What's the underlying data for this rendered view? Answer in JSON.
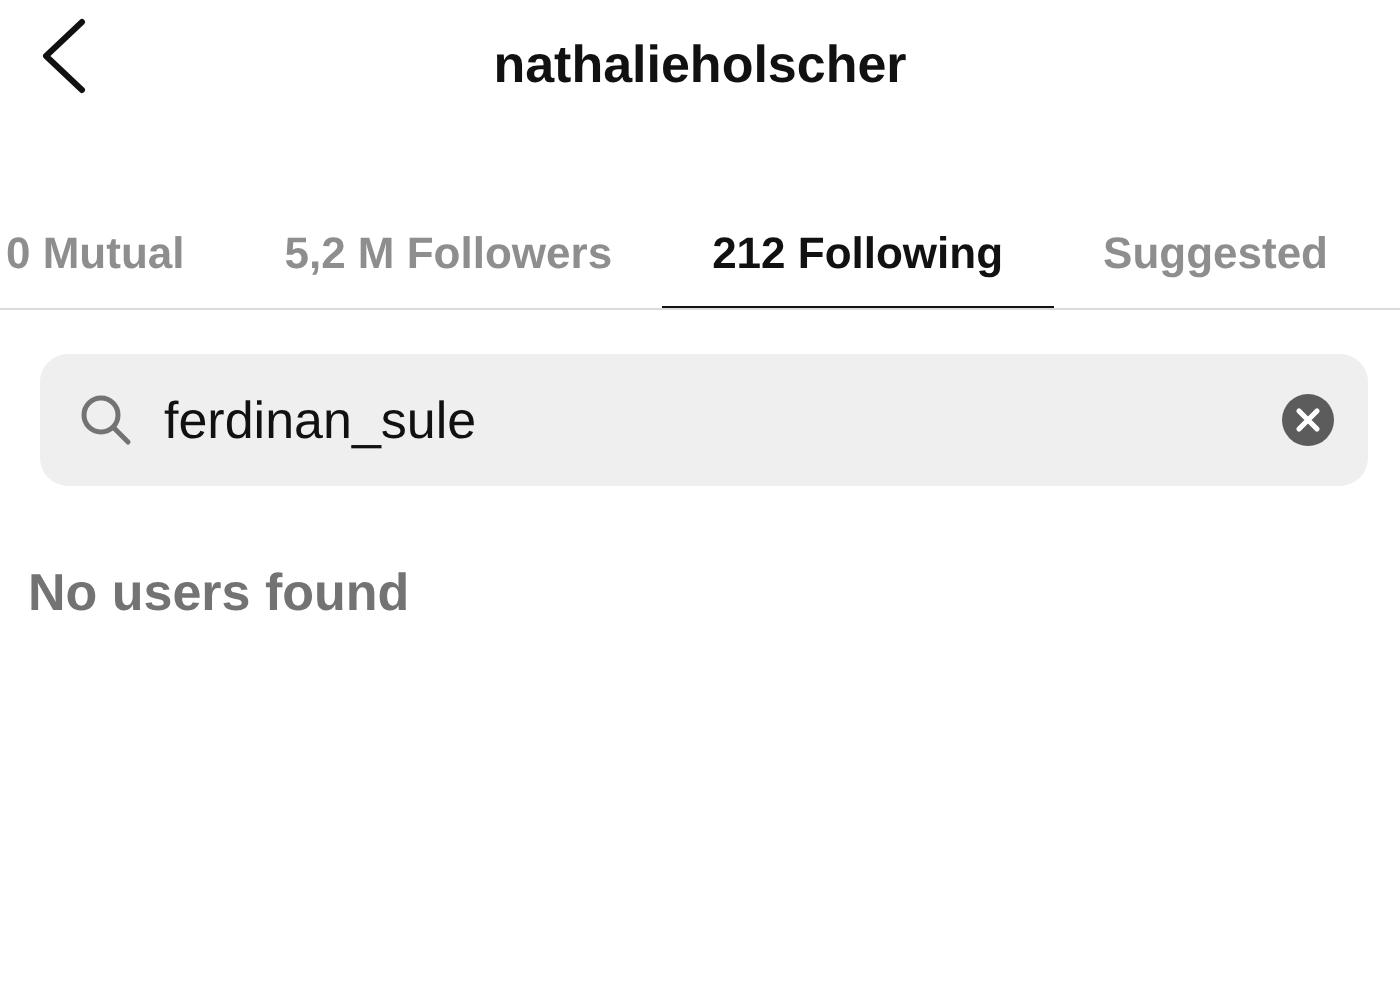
{
  "header": {
    "title": "nathalieholscher"
  },
  "tabs": [
    {
      "label": "0 Mutual",
      "selected": false
    },
    {
      "label": "5,2 M Followers",
      "selected": false
    },
    {
      "label": "212 Following",
      "selected": true
    },
    {
      "label": "Suggested",
      "selected": false
    }
  ],
  "search": {
    "value": "ferdinan_sule"
  },
  "message": "No users found"
}
